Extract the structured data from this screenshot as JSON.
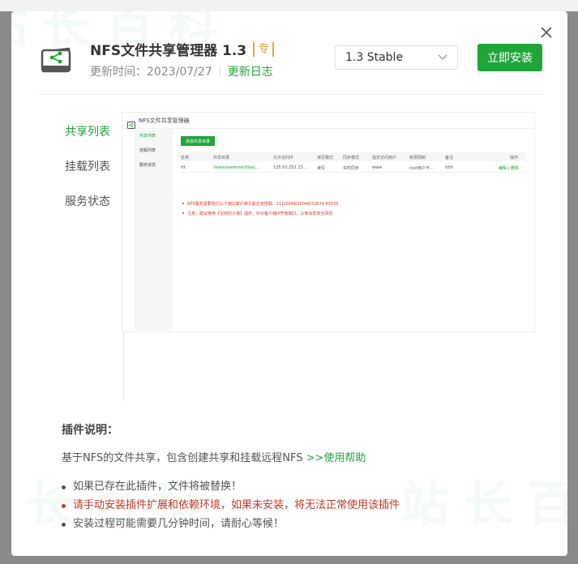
{
  "plugin": {
    "title": "NFS文件共享管理器 1.3",
    "pro_badge": "专",
    "update_time": "更新时间：2023/07/27",
    "changelog": "更新日志",
    "version_selected": "1.3 Stable",
    "install_label": "立即安装"
  },
  "nav": {
    "items": [
      {
        "label": "共享列表",
        "active": true
      },
      {
        "label": "挂载列表",
        "active": false
      },
      {
        "label": "服务状态",
        "active": false
      }
    ]
  },
  "preview": {
    "title": "NFS文件共享管理器",
    "side_items": [
      "共享列表",
      "挂载列表",
      "服务状态"
    ],
    "add_button": "添加共享目录",
    "columns": [
      "名称",
      "共享目录",
      "允许访问IP",
      "读写模式",
      "同步模式",
      "指定访问用户",
      "权限限制",
      "备注",
      "操作"
    ],
    "row": [
      "ttt",
      "/www/wwwroot/fdasj...",
      "125.93.252.23...",
      "读写",
      "实时同步",
      "www",
      "root用户不...",
      "ttttt",
      "编辑 | 删除"
    ],
    "tips": [
      "NFS服务需要放行以下端口客户端才能正常挂载：111/2049/20048/32874-65535",
      "注意：建议使用【宝塔防火墙】插件，针对客户端IP开放端口，以免出现安全风险"
    ]
  },
  "description": {
    "title": "插件说明：",
    "text": "基于NFS的文件共享，包含创建共享和挂载远程NFS",
    "help_link": ">>使用帮助",
    "notes": [
      {
        "text": "如果已存在此插件，文件将被替换！",
        "warn": false
      },
      {
        "text": "请手动安装插件扩展和依赖环境，如果未安装，将无法正常使用该插件",
        "warn": true
      },
      {
        "text": "安装过程可能需要几分钟时间，请耐心等候！",
        "warn": false
      }
    ]
  },
  "watermark": "站长百科",
  "colors": {
    "accent": "#20a53a",
    "warn": "#c0392b",
    "badge": "#e6a23c"
  }
}
